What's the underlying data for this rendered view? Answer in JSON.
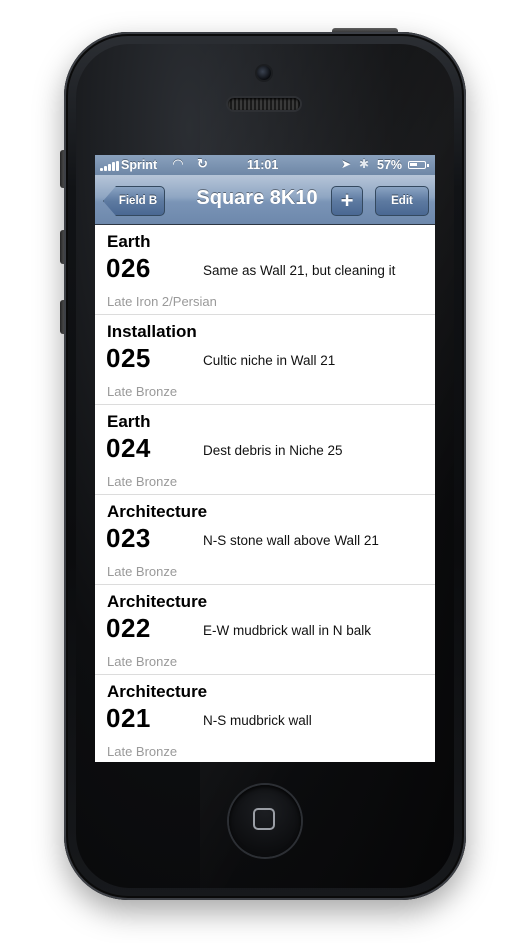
{
  "status_bar": {
    "carrier": "Sprint",
    "time": "11:01",
    "battery": "57%",
    "battery_level": 0.57,
    "icons": [
      "signal-icon",
      "wifi-icon",
      "sync-icon",
      "location-icon",
      "bluetooth-icon",
      "battery-icon"
    ]
  },
  "nav": {
    "back_label": "Field B",
    "title": "Square 8K10",
    "add_label": "+",
    "edit_label": "Edit"
  },
  "loci": [
    {
      "type": "Earth",
      "number": "026",
      "description": "Same as Wall 21, but cleaning it",
      "period": "Late Iron 2/Persian"
    },
    {
      "type": "Installation",
      "number": "025",
      "description": "Cultic niche in Wall 21",
      "period": "Late Bronze"
    },
    {
      "type": "Earth",
      "number": "024",
      "description": "Dest debris in Niche 25",
      "period": "Late Bronze"
    },
    {
      "type": "Architecture",
      "number": "023",
      "description": "N-S stone wall above Wall 21",
      "period": "Late Bronze"
    },
    {
      "type": "Architecture",
      "number": "022",
      "description": "E-W mudbrick wall in N balk",
      "period": "Late Bronze"
    },
    {
      "type": "Architecture",
      "number": "021",
      "description": "N-S mudbrick wall",
      "period": "Late Bronze"
    }
  ],
  "colors": {
    "nav_bar": "#7a94b6",
    "status_bar": "#7a91ae",
    "period_text": "#9a9a9a",
    "phone_body": "#111316"
  }
}
